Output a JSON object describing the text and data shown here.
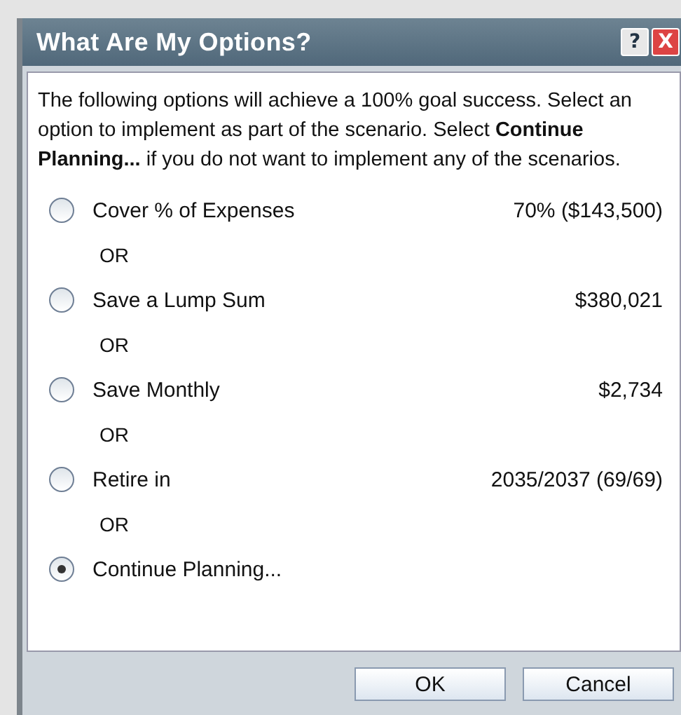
{
  "window": {
    "title": "What Are My Options?",
    "help": "?",
    "close": "X"
  },
  "intro": "The following options will achieve a 100% goal success. Select an option to implement as part of the scenario. Select **Continue Planning...** if you do not want to implement any of the scenarios.",
  "options": [
    {
      "label": "Cover % of Expenses",
      "value": "70% ($143,500)",
      "selected": false
    },
    {
      "label": "Save a Lump Sum",
      "value": "$380,021",
      "selected": false
    },
    {
      "label": "Save Monthly",
      "value": "$2,734",
      "selected": false
    },
    {
      "label": "Retire in",
      "value": "2035/2037 (69/69)",
      "selected": false
    },
    {
      "label": "Continue Planning...",
      "selected": true
    }
  ],
  "separators": [
    "OR",
    "OR",
    "OR",
    "OR"
  ],
  "buttons": [
    "OK",
    "Cancel"
  ]
}
